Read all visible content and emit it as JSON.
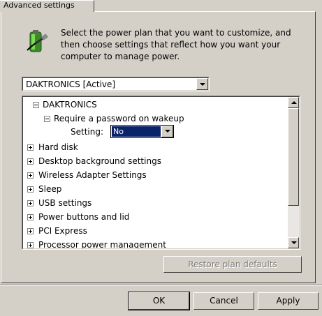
{
  "tab": {
    "label": "Advanced settings"
  },
  "description": "Select the power plan that you want to customize, and then choose settings that reflect how you want your computer to manage power.",
  "plan_combo": {
    "value": "DAKTRONICS [Active]"
  },
  "tree": {
    "root": "DAKTRONICS",
    "child": "Require a password on wakeup",
    "setting_label": "Setting:",
    "setting_value": "No",
    "items": [
      "Hard disk",
      "Desktop background settings",
      "Wireless Adapter Settings",
      "Sleep",
      "USB settings",
      "Power buttons and lid",
      "PCI Express",
      "Processor power management"
    ]
  },
  "buttons": {
    "restore": "Restore plan defaults",
    "ok": "OK",
    "cancel": "Cancel",
    "apply": "Apply"
  },
  "icons": {
    "power_plan": "battery-plug-icon"
  }
}
